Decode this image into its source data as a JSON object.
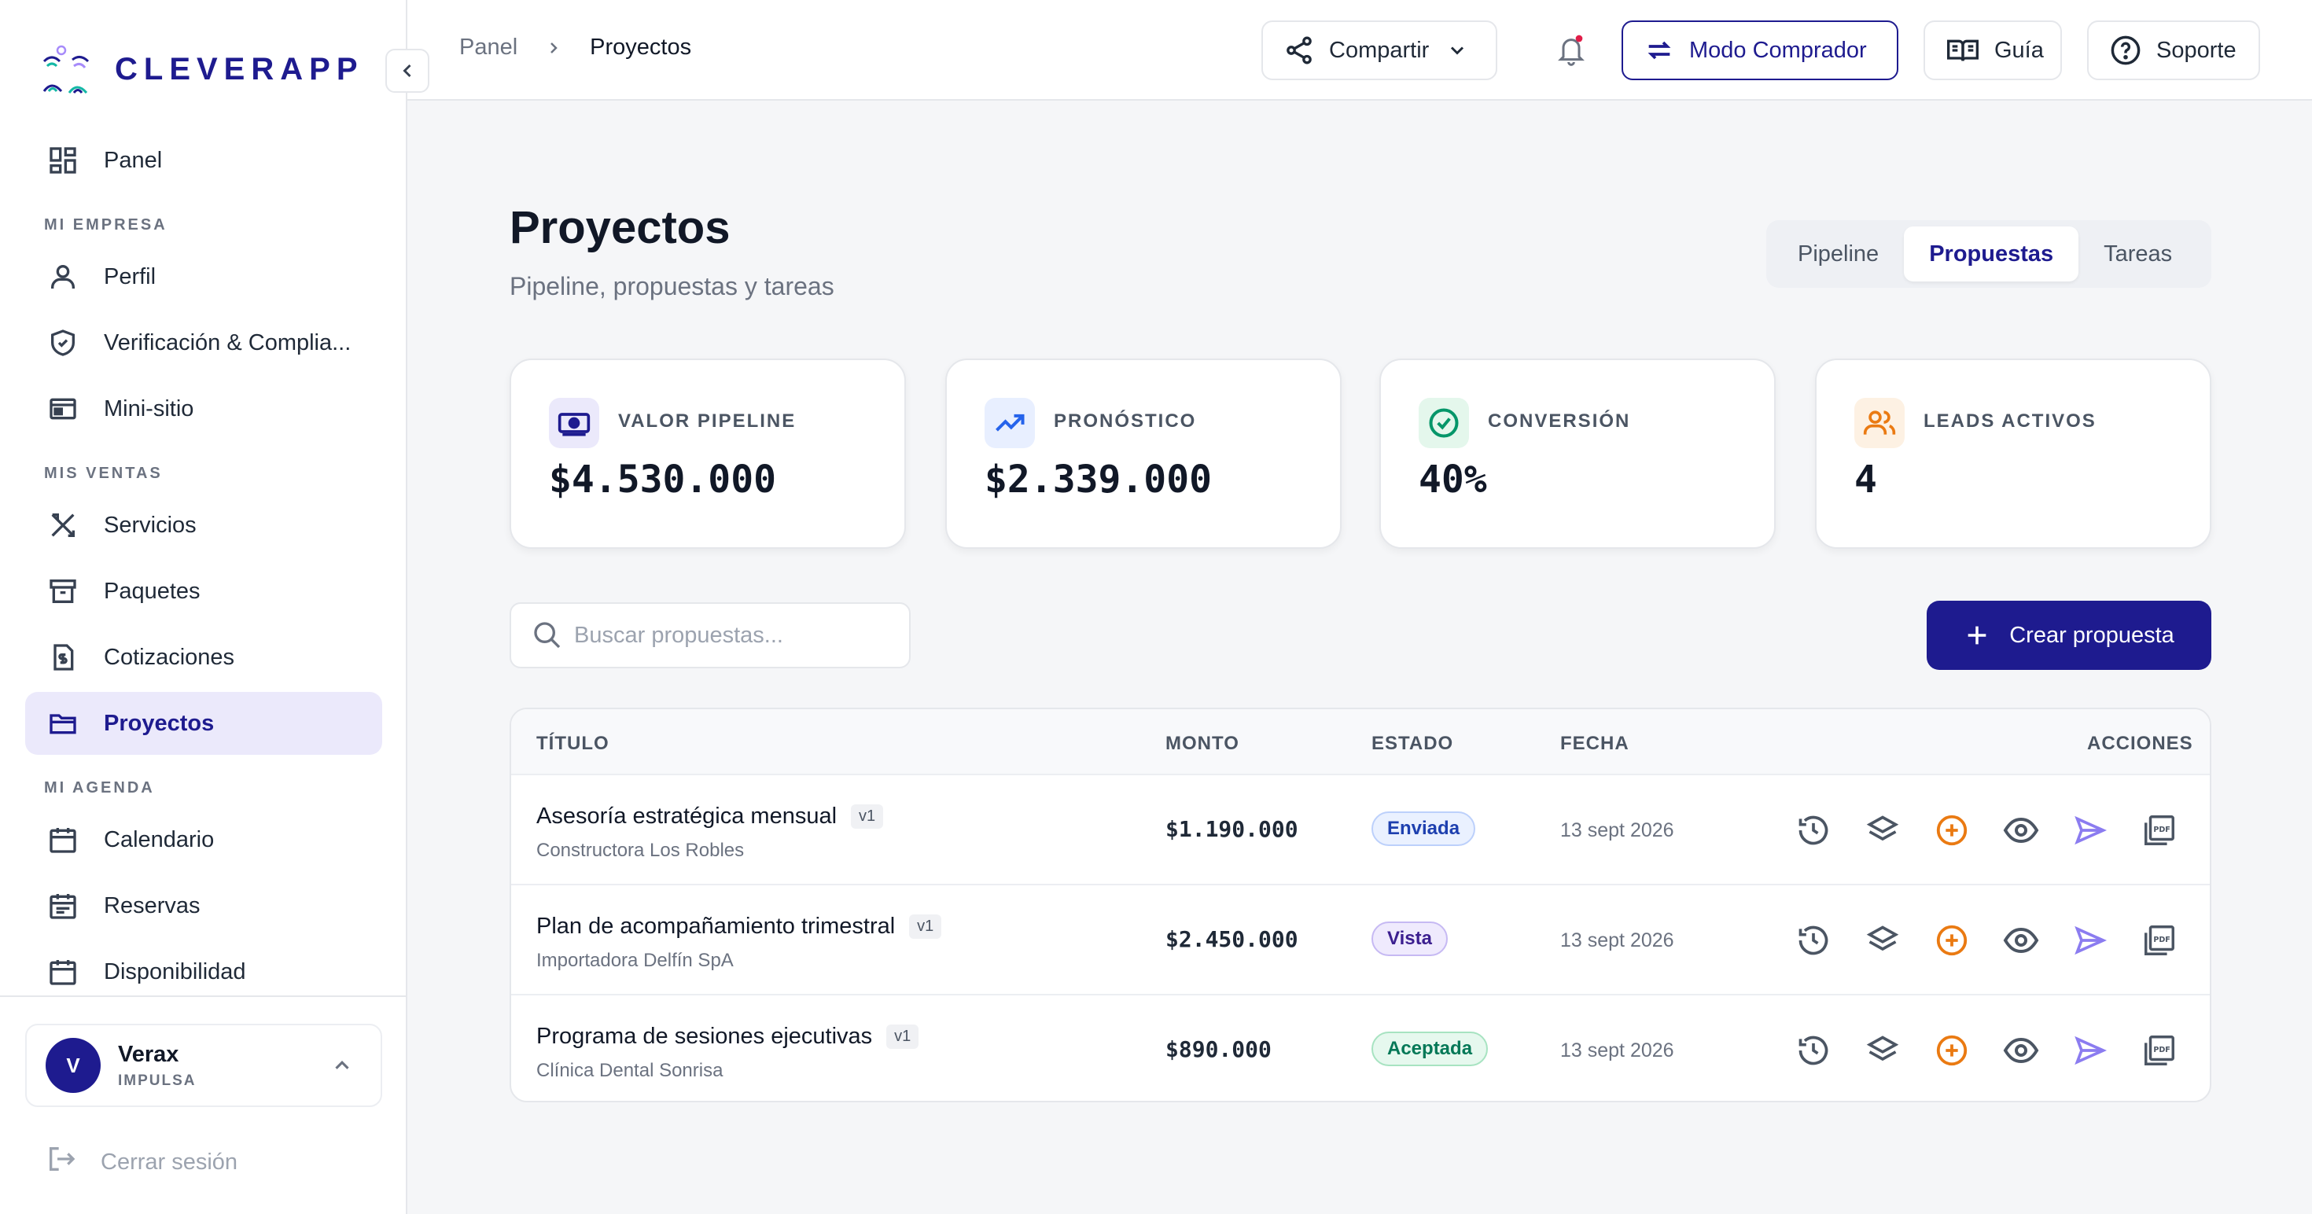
{
  "app": {
    "name": "CLEVERAPP"
  },
  "sidebar": {
    "top_item": {
      "label": "Panel",
      "icon": "dashboard-icon"
    },
    "sections": [
      {
        "title": "MI EMPRESA",
        "items": [
          {
            "label": "Perfil",
            "icon": "user-icon"
          },
          {
            "label": "Verificación & Complia...",
            "icon": "shield-icon"
          },
          {
            "label": "Mini-sitio",
            "icon": "website-icon"
          }
        ]
      },
      {
        "title": "MIS VENTAS",
        "items": [
          {
            "label": "Servicios",
            "icon": "tools-icon"
          },
          {
            "label": "Paquetes",
            "icon": "archive-icon"
          },
          {
            "label": "Cotizaciones",
            "icon": "invoice-icon"
          },
          {
            "label": "Proyectos",
            "icon": "folder-icon",
            "active": true
          }
        ]
      },
      {
        "title": "MI AGENDA",
        "items": [
          {
            "label": "Calendario",
            "icon": "calendar-icon"
          },
          {
            "label": "Reservas",
            "icon": "calendar-list-icon"
          },
          {
            "label": "Disponibilidad",
            "icon": "calendar-grid-icon"
          }
        ]
      }
    ],
    "user": {
      "initial": "V",
      "name": "Verax",
      "plan": "IMPULSA"
    },
    "logout_label": "Cerrar sesión"
  },
  "topbar": {
    "breadcrumb": [
      "Panel",
      "Proyectos"
    ],
    "share_label": "Compartir",
    "buyer_mode_label": "Modo Comprador",
    "guide_label": "Guía",
    "support_label": "Soporte"
  },
  "main": {
    "title": "Proyectos",
    "subtitle": "Pipeline, propuestas y tareas",
    "tabs": [
      {
        "label": "Pipeline"
      },
      {
        "label": "Propuestas",
        "active": true
      },
      {
        "label": "Tareas"
      }
    ],
    "kpis": [
      {
        "label": "VALOR PIPELINE",
        "value": "$4.530.000",
        "icon": "money-icon",
        "color": "#1e1b8f"
      },
      {
        "label": "PRONÓSTICO",
        "value": "$2.339.000",
        "icon": "trending-up-icon",
        "color": "#2563eb"
      },
      {
        "label": "CONVERSIÓN",
        "value": "40%",
        "icon": "check-circle-icon",
        "color": "#059669"
      },
      {
        "label": "LEADS ACTIVOS",
        "value": "4",
        "icon": "users-icon",
        "color": "#ea7a12"
      }
    ],
    "search_placeholder": "Buscar propuestas...",
    "create_label": "Crear propuesta",
    "table": {
      "headers": {
        "title": "TÍTULO",
        "amount": "MONTO",
        "status": "ESTADO",
        "date": "FECHA",
        "actions": "ACCIONES"
      },
      "rows": [
        {
          "title": "Asesoría estratégica mensual",
          "version": "v1",
          "client": "Constructora Los Robles",
          "amount": "$1.190.000",
          "status": "Enviada",
          "date": "13 sept 2026"
        },
        {
          "title": "Plan de acompañamiento trimestral",
          "version": "v1",
          "client": "Importadora Delfín SpA",
          "amount": "$2.450.000",
          "status": "Vista",
          "date": "13 sept 2026"
        },
        {
          "title": "Programa de sesiones ejecutivas",
          "version": "v1",
          "client": "Clínica Dental Sonrisa",
          "amount": "$890.000",
          "status": "Aceptada",
          "date": "13 sept 2026"
        }
      ],
      "row_actions": [
        "history-icon",
        "layers-icon",
        "plus-circle-icon",
        "eye-icon",
        "send-icon",
        "pdf-icon"
      ]
    }
  },
  "colors": {
    "brand": "#1e1b8f",
    "accent_orange": "#ea7a12",
    "send_purple": "#8b7cf0"
  }
}
